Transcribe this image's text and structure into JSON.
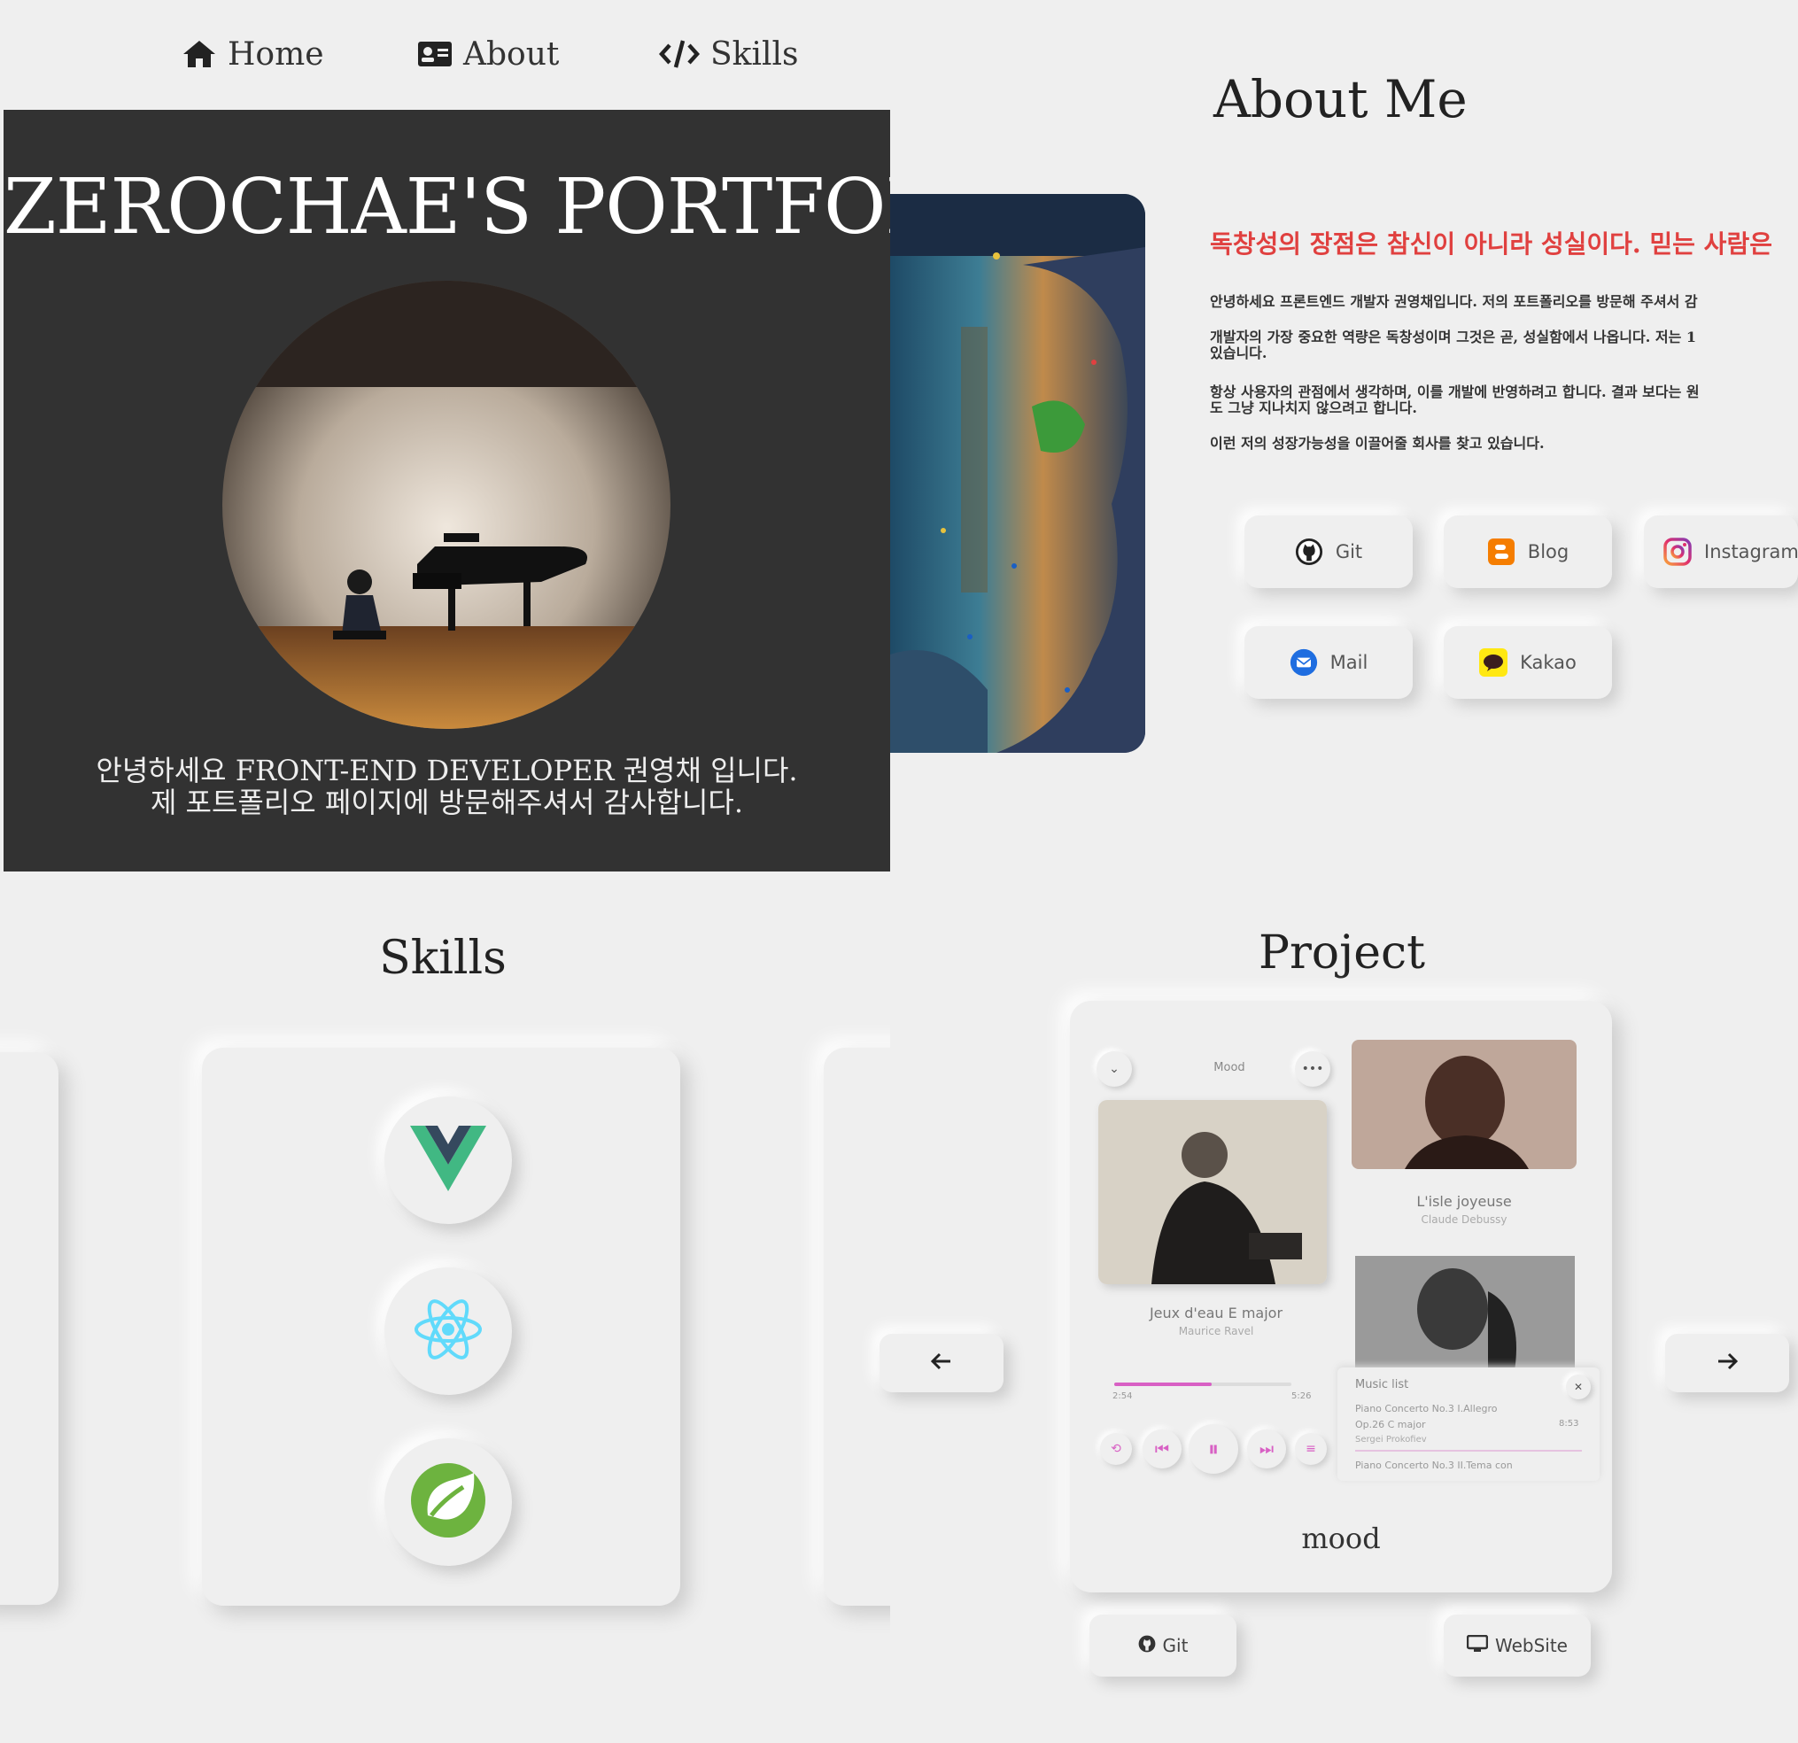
{
  "nav": {
    "home": "Home",
    "about": "About",
    "skills": "Skills"
  },
  "hero": {
    "title": "ZEROCHAE'S PORTFOLIO",
    "line1": "안녕하세요 FRONT-END DEVELOPER 권영채 입니다.",
    "line2": "제 포트폴리오 페이지에 방문해주셔서 감사합니다."
  },
  "about": {
    "title": "About Me",
    "quote": "독창성의 장점은 참신이 아니라 성실이다. 믿는 사람은",
    "p1": "안녕하세요 프론트엔드 개발자 권영채입니다. 저의 포트폴리오를 방문해 주셔서 감",
    "p2": "개발자의 가장 중요한 역량은 독창성이며 그것은 곧, 성실함에서 나옵니다. 저는 1",
    "p2b": "있습니다.",
    "p3": "항상 사용자의 관점에서 생각하며, 이를 개발에 반영하려고 합니다. 결과 보다는 원",
    "p3b": "도 그냥 지나치지 않으려고 합니다.",
    "p4": "이런 저의 성장가능성을 이끌어줄 회사를 찾고 있습니다.",
    "links": {
      "git": "Git",
      "blog": "Blog",
      "instagram": "Instagram",
      "mail": "Mail",
      "kakao": "Kakao"
    }
  },
  "skills": {
    "title": "Skills",
    "icons": [
      "vue-icon",
      "react-icon",
      "spring-icon"
    ]
  },
  "project": {
    "title": "Project",
    "name": "mood",
    "app": {
      "header": "Mood",
      "track1_title": "Jeux d'eau E major",
      "track1_artist": "Maurice Ravel",
      "track2_title": "L'isle joyeuse",
      "track2_artist": "Claude Debussy",
      "time_current": "2:54",
      "time_total": "5:26",
      "progress": 0.55,
      "list_title": "Music list",
      "list_item1_a": "Piano Concerto No.3 I.Allegro",
      "list_item1_b": "Op.26 C major",
      "list_item1_c": "Sergei Prokofiev",
      "list_item1_time": "8:53",
      "list_item2": "Piano Concerto No.3 II.Tema con"
    },
    "buttons": {
      "git": "Git",
      "website": "WebSite"
    }
  },
  "colors": {
    "accent": "#d860c4",
    "quote": "#e0403f",
    "hero_bg": "#323232",
    "page_bg": "#efefef"
  }
}
